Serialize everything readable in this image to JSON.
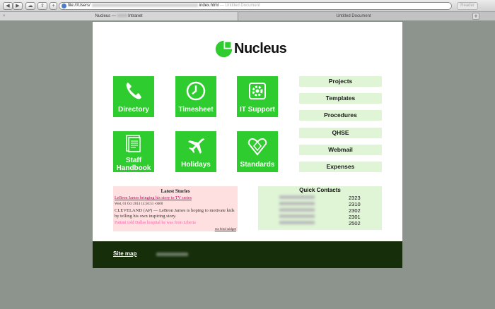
{
  "browser": {
    "nav_back": "◀",
    "nav_forward": "▶",
    "cloud": "☁",
    "share": "⇪",
    "new_tab": "+",
    "url_prefix": "file:///Users/",
    "url_suffix": "index.html",
    "url_doc": "— Untitled Document",
    "reader": "Reader",
    "tabs": [
      {
        "label_prefix": "Nucleus — ",
        "label_suffix": " Intranet",
        "active": true
      },
      {
        "label": "Untitled Document",
        "active": false
      }
    ],
    "add_tab": "+"
  },
  "logo": {
    "text": "Nucleus",
    "color": "#2ecc2e"
  },
  "accent": "#2ecc2e",
  "tiles": [
    {
      "label": "Directory",
      "icon": "phone-icon"
    },
    {
      "label": "Timesheet",
      "icon": "clock-icon"
    },
    {
      "label": "IT Support",
      "icon": "gear-icon"
    },
    {
      "label_line1": "Staff",
      "label_line2": "Handbook",
      "icon": "document-stack-icon"
    },
    {
      "label": "Holidays",
      "icon": "airplane-icon"
    },
    {
      "label": "Standards",
      "icon": "kitemark-icon"
    }
  ],
  "quick_links": [
    "Projects",
    "Templates",
    "Procedures",
    "QHSE",
    "Webmail",
    "Expenses"
  ],
  "stories": {
    "title": "Latest Stories",
    "headline": "LeBron James bringing his story to TV series",
    "date": "Wed, 01 Oct 2014 14:56:51 -0400",
    "body": "CLEVELAND (AP) — LeBron James is hoping to motivate kids by telling his own inspiring story.",
    "next_headline": "Patient told Dallas hospital he was from Liberia",
    "feed_link": "rss feed widget"
  },
  "contacts": {
    "title": "Quick Contacts",
    "extensions": [
      "2323",
      "2310",
      "2302",
      "2301",
      "2502"
    ]
  },
  "footer": {
    "site_map": "Site map"
  }
}
